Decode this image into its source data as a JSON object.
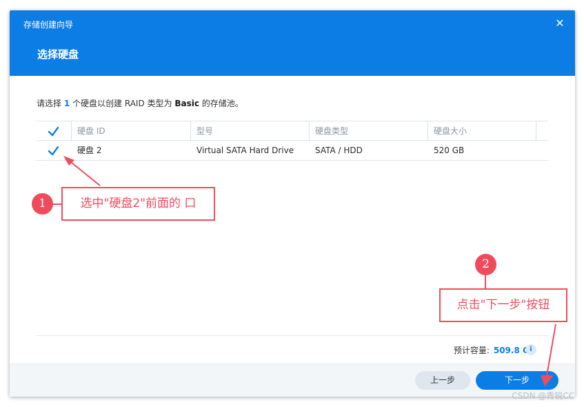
{
  "window": {
    "title": "存储创建向导",
    "close_icon": "close-icon"
  },
  "step": {
    "title": "选择硬盘"
  },
  "instruction": {
    "prefix": "请选择",
    "count": "1",
    "middle": "个硬盘以创建 RAID 类型为",
    "raid_type": "Basic",
    "suffix": "的存储池。"
  },
  "table": {
    "columns": [
      "硬盘 ID",
      "型号",
      "硬盘类型",
      "硬盘大小"
    ],
    "rows": [
      {
        "checked": true,
        "cells": [
          "硬盘 2",
          "Virtual SATA Hard Drive",
          "SATA / HDD",
          "520 GB"
        ]
      }
    ],
    "header_checked": true
  },
  "capacity": {
    "label": "预计容量:",
    "value": "509.8 GB",
    "info_icon": "i"
  },
  "buttons": {
    "prev": "上一步",
    "next": "下一步"
  },
  "annotations": {
    "badge1": "1",
    "callout1": "选中\"硬盘2\"前面的 口",
    "badge2": "2",
    "callout2": "点击\"下一步\"按钮"
  },
  "colors": {
    "accent": "#0d7de6",
    "annotation": "#f04b5c"
  },
  "watermark": "CSDN @青锐CC"
}
